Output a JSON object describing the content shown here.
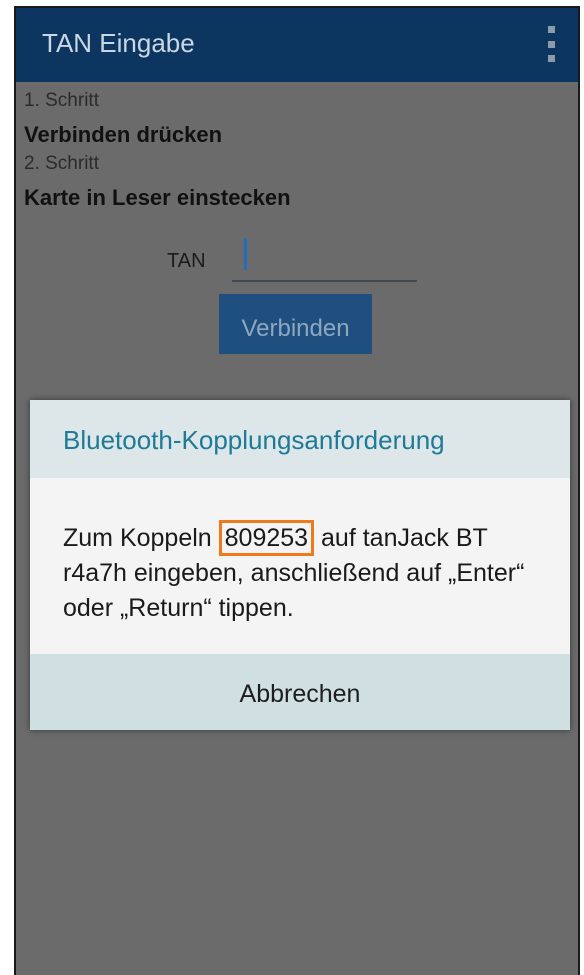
{
  "app_bar": {
    "title": "TAN Eingabe",
    "menu_icon": "overflow-menu-icon"
  },
  "steps": [
    {
      "label": "1. Schritt",
      "text": "Verbinden drücken"
    },
    {
      "label": "2. Schritt",
      "text": "Karte in Leser einstecken"
    }
  ],
  "tan_field": {
    "label": "TAN",
    "value": ""
  },
  "connect_button": {
    "label": "Verbinden"
  },
  "dialog": {
    "title": "Bluetooth-Kopplungsanforderung",
    "message_pre": "Zum Koppeln ",
    "pairing_code": "809253",
    "message_post": " auf tanJack BT r4a7h eingeben, anschließend auf „Enter“ oder „Return“ tippen.",
    "cancel_label": "Abbrechen"
  },
  "colors": {
    "app_bar": "#0c3560",
    "dialog_title": "#1e7a96",
    "code_highlight": "#ee7a1c",
    "scrim": "#6b6b6b"
  }
}
